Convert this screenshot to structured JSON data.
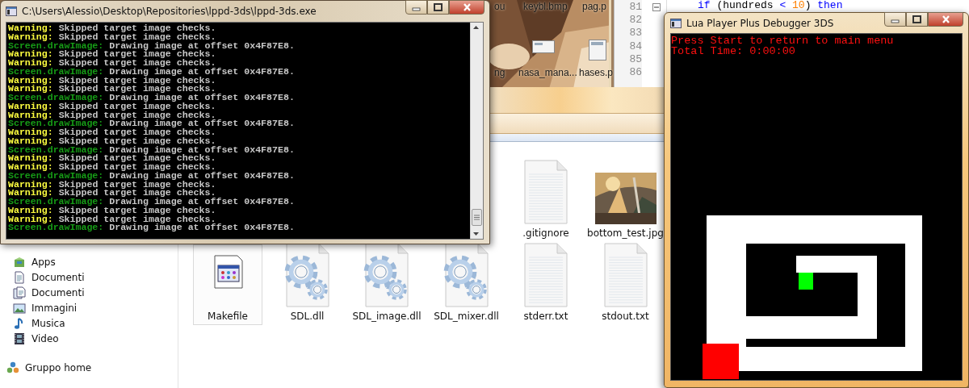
{
  "desktop_icons": [
    {
      "label": "ou"
    },
    {
      "label": "keybl.bmp"
    },
    {
      "label": "pag.p"
    },
    {
      "label": "ng"
    },
    {
      "label": "nasa_mana..."
    },
    {
      "label": "hases.p"
    }
  ],
  "editor": {
    "line_numbers": [
      "81",
      "82",
      "83",
      "84",
      "85",
      "86"
    ],
    "code_line": [
      {
        "text": "if ",
        "kind": "keyword"
      },
      {
        "text": "(hundreds ",
        "kind": "plain"
      },
      {
        "text": "< ",
        "kind": "keyword"
      },
      {
        "text": "10",
        "kind": "number"
      },
      {
        "text": ") ",
        "kind": "plain"
      },
      {
        "text": "then",
        "kind": "keyword"
      }
    ]
  },
  "explorer": {
    "sidebar": [
      {
        "label": "Apps",
        "kind": "apps"
      },
      {
        "label": "Documenti",
        "kind": "documents"
      },
      {
        "label": "Documenti",
        "kind": "shared"
      },
      {
        "label": "Immagini",
        "kind": "pictures"
      },
      {
        "label": "Musica",
        "kind": "music"
      },
      {
        "label": "Video",
        "kind": "video"
      },
      {
        "label": "Gruppo home",
        "kind": "homegroup"
      }
    ],
    "files": [
      [
        {
          "label": ".gitignore",
          "kind": "text",
          "selected": false
        },
        {
          "label": "bottom_test.jpg",
          "selected": false
        }
      ],
      [
        {
          "label": "Makefile",
          "kind": "makefile",
          "selected": true
        },
        {
          "label": "SDL.dll",
          "kind": "dll",
          "selected": false
        },
        {
          "label": "SDL_image.dll",
          "kind": "dll",
          "selected": false
        },
        {
          "label": "SDL_mixer.dll",
          "kind": "dll",
          "selected": false
        },
        {
          "label": "stderr.txt",
          "kind": "text",
          "selected": false
        },
        {
          "label": "stdout.txt",
          "kind": "text",
          "selected": false
        }
      ]
    ]
  },
  "console": {
    "title": "C:\\Users\\Alessio\\Desktop\\Repositories\\lppd-3ds\\lppd-3ds.exe",
    "lines": [
      {
        "kind": "warning",
        "tag": "Warning:",
        "message": "Skipped target image checks."
      },
      {
        "kind": "warning",
        "tag": "Warning:",
        "message": "Skipped target image checks."
      },
      {
        "kind": "draw",
        "tag": "Screen.drawImage:",
        "message": "Drawing image at offset 0x4F87E8."
      },
      {
        "kind": "warning",
        "tag": "Warning:",
        "message": "Skipped target image checks."
      },
      {
        "kind": "warning",
        "tag": "Warning:",
        "message": "Skipped target image checks."
      },
      {
        "kind": "draw",
        "tag": "Screen.drawImage:",
        "message": "Drawing image at offset 0x4F87E8."
      },
      {
        "kind": "warning",
        "tag": "Warning:",
        "message": "Skipped target image checks."
      },
      {
        "kind": "warning",
        "tag": "Warning:",
        "message": "Skipped target image checks."
      },
      {
        "kind": "draw",
        "tag": "Screen.drawImage:",
        "message": "Drawing image at offset 0x4F87E8."
      },
      {
        "kind": "warning",
        "tag": "Warning:",
        "message": "Skipped target image checks."
      },
      {
        "kind": "warning",
        "tag": "Warning:",
        "message": "Skipped target image checks."
      },
      {
        "kind": "draw",
        "tag": "Screen.drawImage:",
        "message": "Drawing image at offset 0x4F87E8."
      },
      {
        "kind": "warning",
        "tag": "Warning:",
        "message": "Skipped target image checks."
      },
      {
        "kind": "warning",
        "tag": "Warning:",
        "message": "Skipped target image checks."
      },
      {
        "kind": "draw",
        "tag": "Screen.drawImage:",
        "message": "Drawing image at offset 0x4F87E8."
      },
      {
        "kind": "warning",
        "tag": "Warning:",
        "message": "Skipped target image checks."
      },
      {
        "kind": "warning",
        "tag": "Warning:",
        "message": "Skipped target image checks."
      },
      {
        "kind": "draw",
        "tag": "Screen.drawImage:",
        "message": "Drawing image at offset 0x4F87E8."
      },
      {
        "kind": "warning",
        "tag": "Warning:",
        "message": "Skipped target image checks."
      },
      {
        "kind": "warning",
        "tag": "Warning:",
        "message": "Skipped target image checks."
      },
      {
        "kind": "draw",
        "tag": "Screen.drawImage:",
        "message": "Drawing image at offset 0x4F87E8."
      },
      {
        "kind": "warning",
        "tag": "Warning:",
        "message": "Skipped target image checks."
      },
      {
        "kind": "warning",
        "tag": "Warning:",
        "message": "Skipped target image checks."
      },
      {
        "kind": "draw",
        "tag": "Screen.drawImage:",
        "message": "Drawing image at offset 0x4F87E8."
      }
    ]
  },
  "debugger": {
    "title": "Lua Player Plus Debugger 3DS",
    "lines": [
      "Press Start to return to main menu",
      "Total Time: 0:00:00"
    ]
  }
}
